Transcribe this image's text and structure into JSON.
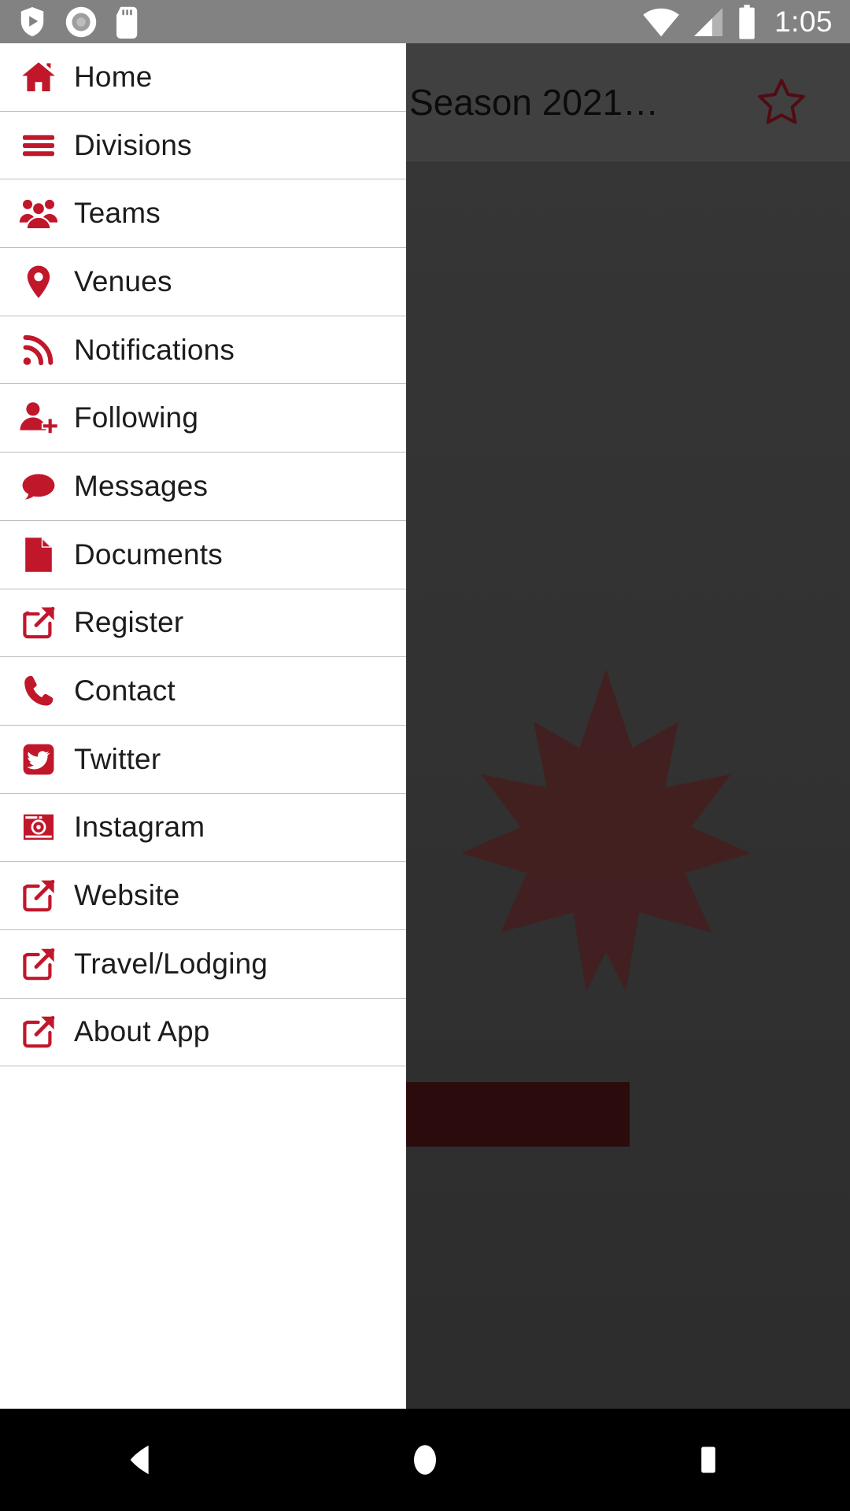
{
  "status_bar": {
    "clock": "1:05",
    "left_icons": [
      {
        "name": "play-protect-icon",
        "label": "play-protect"
      },
      {
        "name": "disc-record-icon",
        "label": "recording"
      },
      {
        "name": "sd-card-icon",
        "label": "sd-card"
      }
    ],
    "right_icons": [
      {
        "name": "wifi-icon",
        "label": "wifi"
      },
      {
        "name": "cellular-signal-icon",
        "label": "cellular"
      },
      {
        "name": "battery-icon",
        "label": "battery"
      }
    ]
  },
  "app_bar": {
    "title": "Season 2021…",
    "favorite_icon": "star-outline-icon"
  },
  "drawer": {
    "items": [
      {
        "label": "Home",
        "icon": "home-icon"
      },
      {
        "label": "Divisions",
        "icon": "list-lines-icon"
      },
      {
        "label": "Teams",
        "icon": "users-group-icon"
      },
      {
        "label": "Venues",
        "icon": "map-pin-icon"
      },
      {
        "label": "Notifications",
        "icon": "rss-feed-icon"
      },
      {
        "label": "Following",
        "icon": "user-plus-icon"
      },
      {
        "label": "Messages",
        "icon": "chat-bubble-icon"
      },
      {
        "label": "Documents",
        "icon": "file-document-icon"
      },
      {
        "label": "Register",
        "icon": "external-link-icon"
      },
      {
        "label": "Contact",
        "icon": "phone-icon"
      },
      {
        "label": "Twitter",
        "icon": "twitter-icon"
      },
      {
        "label": "Instagram",
        "icon": "instagram-camera-icon"
      },
      {
        "label": "Website",
        "icon": "external-link-icon"
      },
      {
        "label": "Travel/Lodging",
        "icon": "external-link-icon"
      },
      {
        "label": "About App",
        "icon": "external-link-icon"
      }
    ]
  },
  "system_nav": {
    "buttons": [
      {
        "name": "back-button",
        "icon": "triangle-left-icon"
      },
      {
        "name": "home-button",
        "icon": "circle-icon"
      },
      {
        "name": "recents-button",
        "icon": "square-icon"
      }
    ]
  },
  "colors": {
    "brand_red": "#c1172b",
    "dark_red": "#9e1b24",
    "drawer_bg": "#ffffff",
    "divider": "#bdbdbd",
    "text": "#1c1c1c",
    "status_bar": "#828282"
  }
}
